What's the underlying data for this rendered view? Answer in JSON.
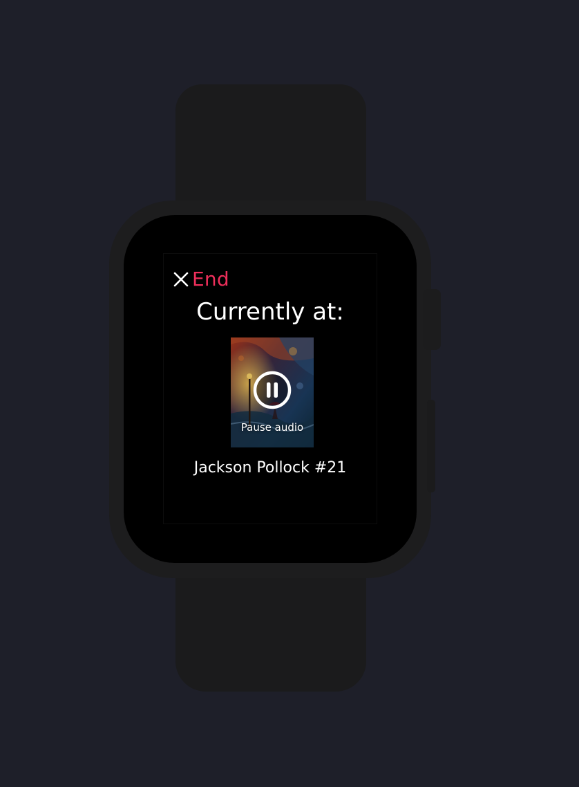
{
  "colors": {
    "background": "#1e1f29",
    "accent": "#ef2f5b",
    "screen": "#000000",
    "text": "#ffffff"
  },
  "header": {
    "close_icon": "close-icon",
    "end_label": "End"
  },
  "main": {
    "heading": "Currently at:",
    "pause_icon": "pause-icon",
    "pause_label": "Pause audio",
    "artwork_title": "Jackson Pollock #21"
  }
}
